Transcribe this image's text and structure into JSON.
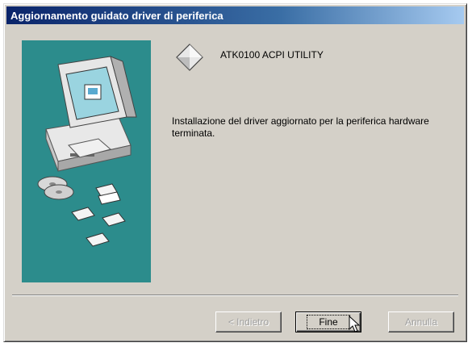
{
  "window": {
    "title": "Aggiornamento guidato driver di periferica"
  },
  "device": {
    "name": "ATK0100 ACPI UTILITY",
    "icon": "device-diamond-icon"
  },
  "message": "Installazione del driver aggiornato per la periferica hardware terminata.",
  "buttons": {
    "back": "< Indietro",
    "finish": "Fine",
    "cancel": "Annulla"
  },
  "colors": {
    "titlebar_start": "#0a246a",
    "titlebar_end": "#a6caf0",
    "side_panel": "#2c8c8c",
    "dialog_face": "#d4d0c8"
  }
}
